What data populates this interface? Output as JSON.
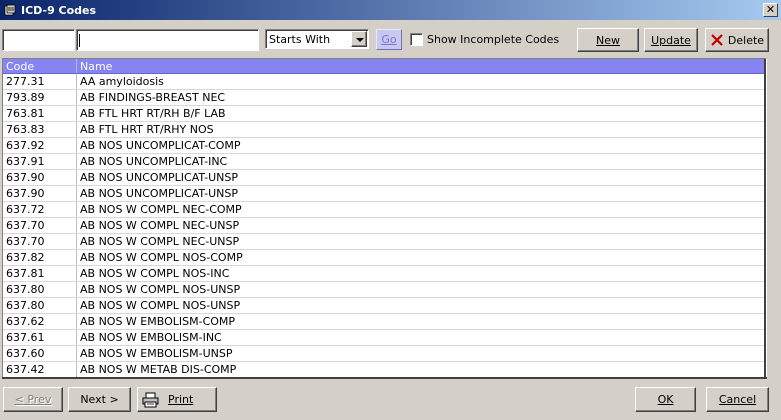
{
  "window": {
    "title": "ICD-9 Codes",
    "close_glyph": "✕"
  },
  "toolbar": {
    "code_input_value": "",
    "name_input_value": "",
    "match_mode": "Starts With",
    "go_label": "Go",
    "show_incomplete_label": "Show Incomplete Codes",
    "show_incomplete_checked": false,
    "new_label": "New",
    "update_label": "Update",
    "delete_label": "Delete"
  },
  "grid": {
    "columns": [
      "Code",
      "Name"
    ],
    "rows": [
      {
        "code": "277.31",
        "name": "AA amyloidosis"
      },
      {
        "code": "793.89",
        "name": "AB FINDINGS-BREAST NEC"
      },
      {
        "code": "763.81",
        "name": "AB FTL HRT RT/RH B/F LAB"
      },
      {
        "code": "763.83",
        "name": "AB FTL HRT RT/RHY NOS"
      },
      {
        "code": "637.92",
        "name": "AB NOS UNCOMPLICAT-COMP"
      },
      {
        "code": "637.91",
        "name": "AB NOS UNCOMPLICAT-INC"
      },
      {
        "code": "637.90",
        "name": "AB NOS UNCOMPLICAT-UNSP"
      },
      {
        "code": "637.90",
        "name": "AB NOS UNCOMPLICAT-UNSP"
      },
      {
        "code": "637.72",
        "name": "AB NOS W COMPL NEC-COMP"
      },
      {
        "code": "637.70",
        "name": "AB NOS W COMPL NEC-UNSP"
      },
      {
        "code": "637.70",
        "name": "AB NOS W COMPL NEC-UNSP"
      },
      {
        "code": "637.82",
        "name": "AB NOS W COMPL NOS-COMP"
      },
      {
        "code": "637.81",
        "name": "AB NOS W COMPL NOS-INC"
      },
      {
        "code": "637.80",
        "name": "AB NOS W COMPL NOS-UNSP"
      },
      {
        "code": "637.80",
        "name": "AB NOS W COMPL NOS-UNSP"
      },
      {
        "code": "637.62",
        "name": "AB NOS W EMBOLISM-COMP"
      },
      {
        "code": "637.61",
        "name": "AB NOS W EMBOLISM-INC"
      },
      {
        "code": "637.60",
        "name": "AB NOS W EMBOLISM-UNSP"
      },
      {
        "code": "637.42",
        "name": "AB NOS W METAB DIS-COMP"
      }
    ]
  },
  "footer": {
    "prev_label": "< Prev",
    "next_label": "Next >",
    "print_label": "Print",
    "ok_label": "OK",
    "cancel_label": "Cancel"
  },
  "colors": {
    "header_bg": "#8584f0",
    "titlebar_start": "#0a246a",
    "delete_icon": "#c00000"
  }
}
